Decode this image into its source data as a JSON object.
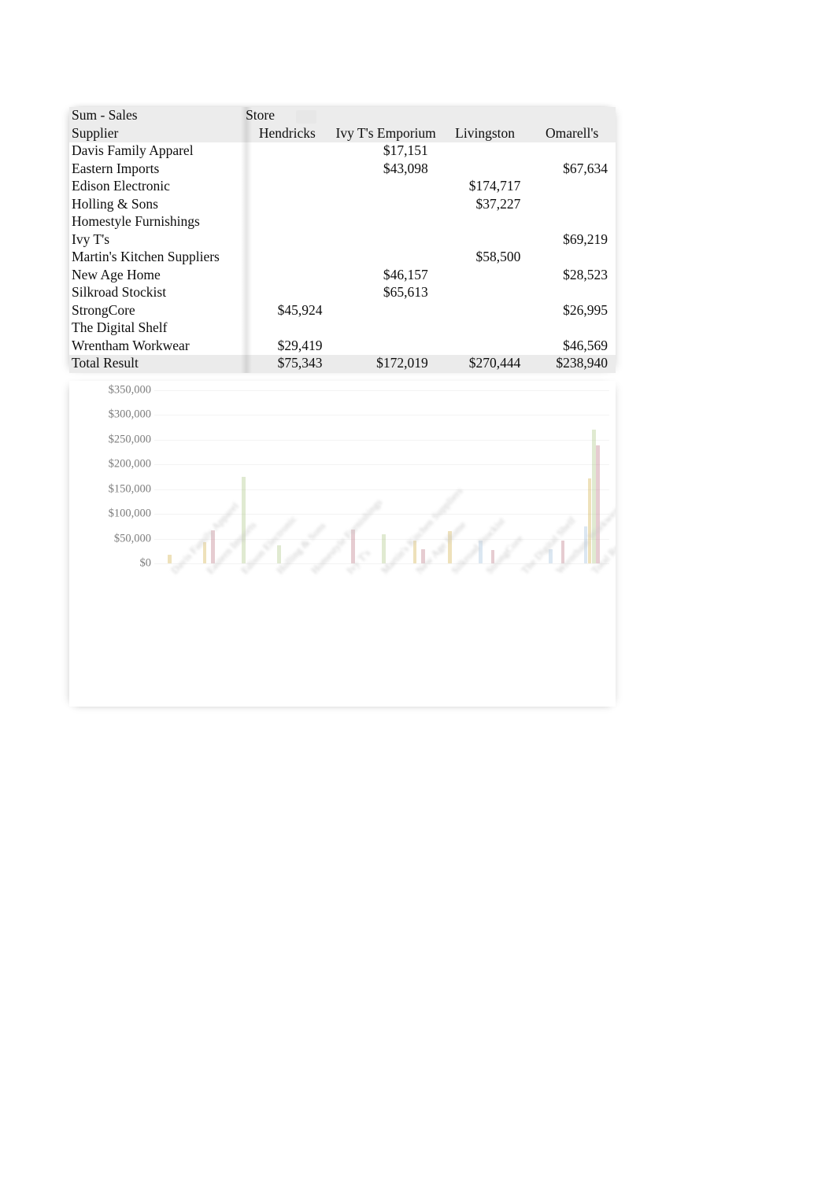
{
  "pivot": {
    "value_field_label": "Sum - Sales",
    "column_field_label": "Store",
    "row_field_label": "Supplier",
    "columns": [
      "Hendricks",
      "Ivy T's Emporium",
      "Livingston",
      "Omarell's"
    ],
    "rows": [
      {
        "supplier": "Davis Family Apparel",
        "values": [
          "",
          "$17,151",
          "",
          ""
        ]
      },
      {
        "supplier": "Eastern Imports",
        "values": [
          "",
          "$43,098",
          "",
          "$67,634"
        ]
      },
      {
        "supplier": "Edison Electronic",
        "values": [
          "",
          "",
          "$174,717",
          ""
        ]
      },
      {
        "supplier": "Holling & Sons",
        "values": [
          "",
          "",
          "$37,227",
          ""
        ]
      },
      {
        "supplier": "Homestyle Furnishings",
        "values": [
          "",
          "",
          "",
          ""
        ]
      },
      {
        "supplier": "Ivy T's",
        "values": [
          "",
          "",
          "",
          "$69,219"
        ]
      },
      {
        "supplier": "Martin's Kitchen Suppliers",
        "values": [
          "",
          "",
          "$58,500",
          ""
        ]
      },
      {
        "supplier": "New Age Home",
        "values": [
          "",
          "$46,157",
          "",
          "$28,523"
        ]
      },
      {
        "supplier": "Silkroad Stockist",
        "values": [
          "",
          "$65,613",
          "",
          ""
        ]
      },
      {
        "supplier": "StrongCore",
        "values": [
          "$45,924",
          "",
          "",
          "$26,995"
        ]
      },
      {
        "supplier": "The Digital Shelf",
        "values": [
          "",
          "",
          "",
          ""
        ]
      },
      {
        "supplier": "Wrentham Workwear",
        "values": [
          "$29,419",
          "",
          "",
          "$46,569"
        ]
      }
    ],
    "total_row": {
      "label": "Total Result",
      "values": [
        "$75,343",
        "$172,019",
        "$270,444",
        "$238,940"
      ]
    }
  },
  "chart_data": {
    "type": "bar",
    "title": "",
    "xlabel": "",
    "ylabel": "",
    "ylim": [
      0,
      350000
    ],
    "ytick_labels": [
      "$350,000",
      "$300,000",
      "$250,000",
      "$200,000",
      "$150,000",
      "$100,000",
      "$50,000",
      "$0"
    ],
    "ytick_values": [
      350000,
      300000,
      250000,
      200000,
      150000,
      100000,
      50000,
      0
    ],
    "grid": true,
    "legend": "none",
    "categories": [
      "Davis Family Apparel",
      "Eastern Imports",
      "Edison Electronic",
      "Holling & Sons",
      "Homestyle Furnishings",
      "Ivy T's",
      "Martin's Kitchen Suppliers",
      "New Age Home",
      "Silkroad Stockist",
      "StrongCore",
      "The Digital Shelf",
      "Wrentham Workwear",
      "Total Result"
    ],
    "series": [
      {
        "name": "Hendricks",
        "color": "#8fb4d6",
        "values": [
          0,
          0,
          0,
          0,
          0,
          0,
          0,
          0,
          0,
          45924,
          0,
          29419,
          75343
        ]
      },
      {
        "name": "Ivy T's Emporium",
        "color": "#c9a227",
        "values": [
          17151,
          43098,
          0,
          0,
          0,
          0,
          0,
          46157,
          65613,
          0,
          0,
          0,
          172019
        ]
      },
      {
        "name": "Livingston",
        "color": "#9ebe6f",
        "values": [
          0,
          0,
          174717,
          37227,
          0,
          0,
          58500,
          0,
          0,
          0,
          0,
          0,
          270444
        ]
      },
      {
        "name": "Omarell's",
        "color": "#b06070",
        "values": [
          0,
          67634,
          0,
          0,
          0,
          69219,
          0,
          28523,
          0,
          26995,
          0,
          46569,
          238940
        ]
      }
    ]
  }
}
